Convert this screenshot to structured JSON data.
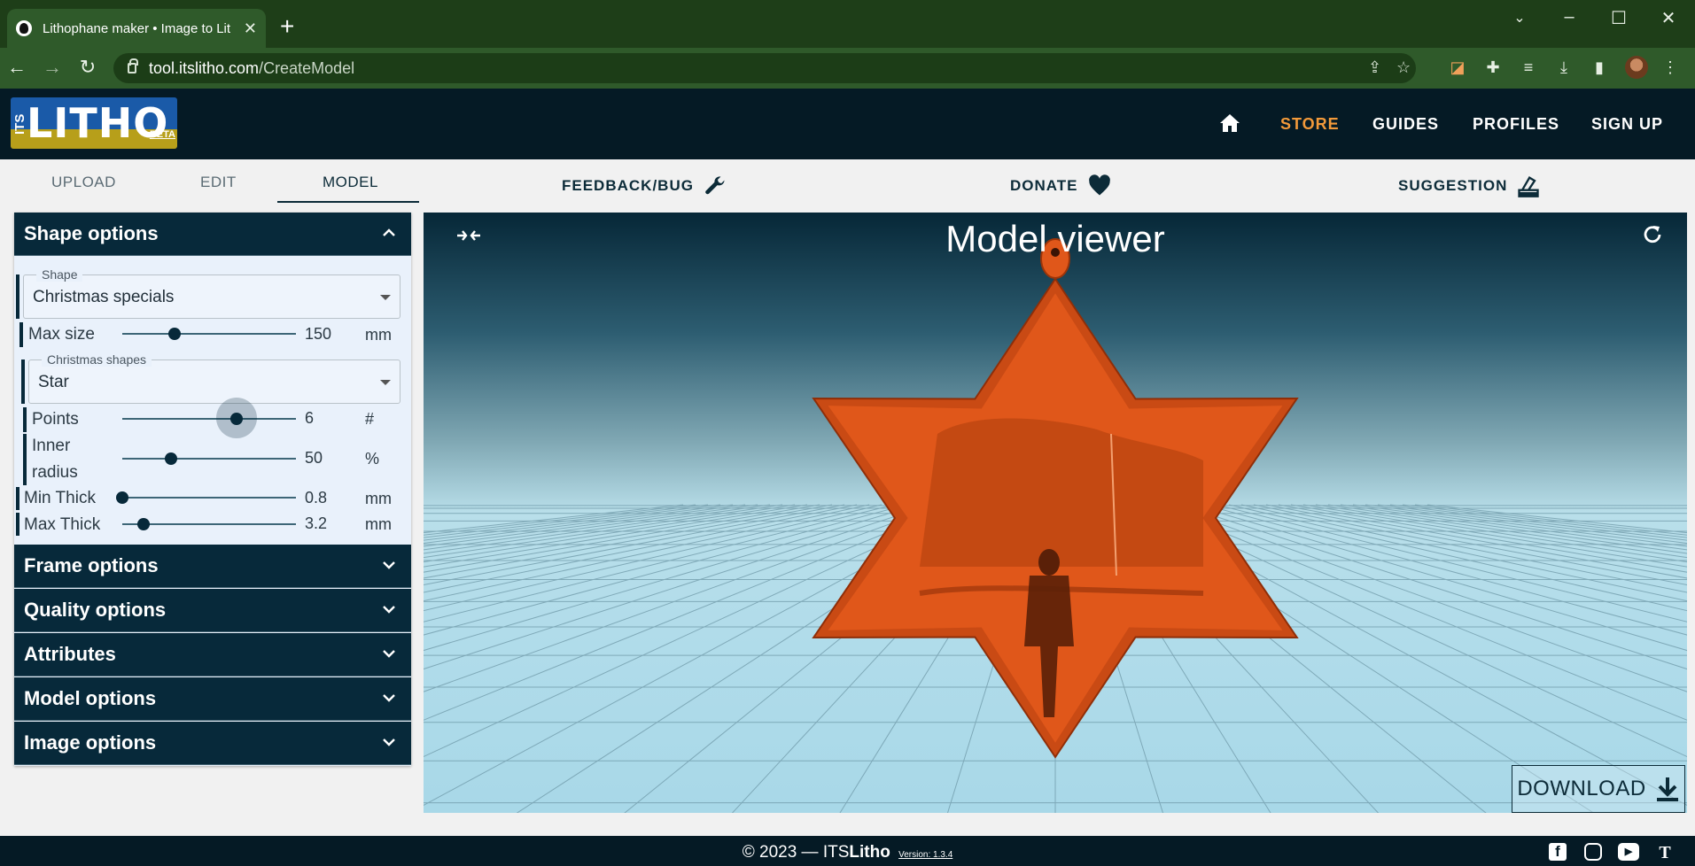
{
  "browser": {
    "tab_title": "Lithophane maker • Image to Lit",
    "url_host": "tool.itslitho.com",
    "url_path": "/CreateModel"
  },
  "site": {
    "logo_its": "ITS",
    "logo_litho": "LITHO",
    "logo_beta": "BETA",
    "nav": [
      "STORE",
      "GUIDES",
      "PROFILES",
      "SIGN UP"
    ]
  },
  "subtabs": {
    "upload": "UPLOAD",
    "edit": "EDIT",
    "model": "MODEL"
  },
  "links": {
    "feedback": "FEEDBACK/BUG",
    "donate": "DONATE",
    "suggestion": "SUGGESTION"
  },
  "panel": {
    "shape_options": "Shape options",
    "shape_legend": "Shape",
    "shape_value": "Christmas specials",
    "max_size": {
      "label": "Max size",
      "value": "150",
      "unit": "mm",
      "level": 0.3
    },
    "christmas_legend": "Christmas shapes",
    "christmas_value": "Star",
    "points": {
      "label": "Points",
      "value": "6",
      "unit": "#",
      "level": 0.66
    },
    "inner_radius": {
      "label1": "Inner",
      "label2": "radius",
      "value": "50",
      "unit": "%",
      "level": 0.28
    },
    "min_thick": {
      "label": "Min Thick",
      "value": "0.8",
      "unit": "mm",
      "level": 0.0
    },
    "max_thick": {
      "label": "Max Thick",
      "value": "3.2",
      "unit": "mm",
      "level": 0.12
    },
    "sections": [
      "Frame options",
      "Quality options",
      "Attributes",
      "Model options",
      "Image options"
    ]
  },
  "viewer": {
    "title": "Model viewer",
    "download": "DOWNLOAD",
    "model_color": "#e0571a"
  },
  "footer": {
    "copyright": "© 2023 — ITS",
    "brand": "Litho",
    "version": "Version: 1.3.4",
    "social": [
      "facebook-icon",
      "instagram-icon",
      "youtube-icon",
      "thingiverse-icon"
    ]
  }
}
